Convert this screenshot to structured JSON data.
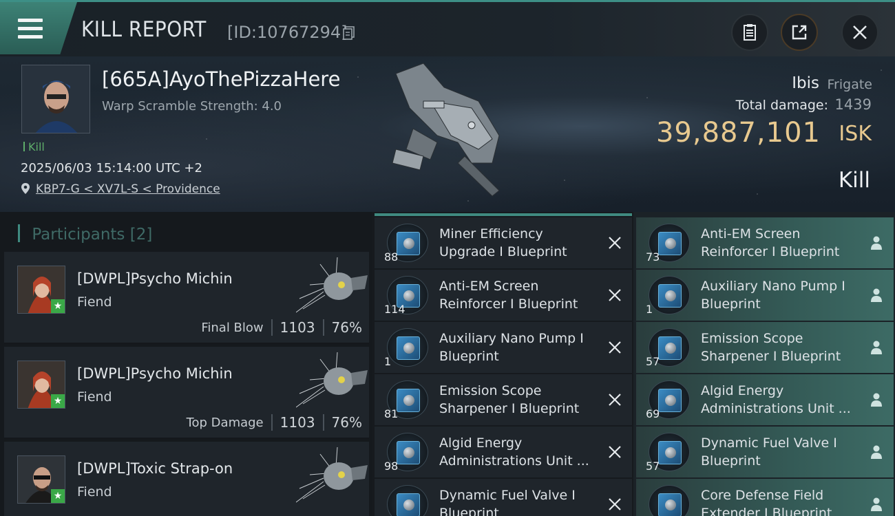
{
  "header": {
    "title": "KILL REPORT",
    "report_id": "[ID:10767294]"
  },
  "victim": {
    "pilot_name": "[665A]AyoThePizzaHere",
    "warp_scramble": "Warp Scramble Strength: 4.0",
    "kill_tag": "Kill",
    "timestamp": "2025/06/03 15:14:00 UTC +2",
    "location": "KBP7-G < XV7L-S < Providence",
    "ship_name": "Ibis",
    "ship_class": "Frigate",
    "total_damage_label": "Total damage:",
    "total_damage_value": "1439",
    "isk_value": "39,887,101",
    "isk_unit": "ISK",
    "result": "Kill"
  },
  "participants": {
    "header": "Participants",
    "count": "[2]",
    "rows": [
      {
        "name": "[DWPL]Psycho Michin",
        "ship": "Fiend",
        "stat_label": "Final Blow",
        "damage": "1103",
        "percent": "76%"
      },
      {
        "name": "[DWPL]Psycho Michin",
        "ship": "Fiend",
        "stat_label": "Top Damage",
        "damage": "1103",
        "percent": "76%"
      },
      {
        "name": "[DWPL]Toxic Strap-on",
        "ship": "Fiend",
        "stat_label": "",
        "damage": "",
        "percent": ""
      }
    ]
  },
  "dropped_items": [
    {
      "qty": "88",
      "line1": "Miner Efficiency",
      "line2": "Upgrade I Blueprint"
    },
    {
      "qty": "114",
      "line1": "Anti-EM Screen",
      "line2": "Reinforcer I Blueprint"
    },
    {
      "qty": "1",
      "line1": "Auxiliary Nano Pump I",
      "line2": "Blueprint"
    },
    {
      "qty": "81",
      "line1": "Emission Scope",
      "line2": "Sharpener I Blueprint"
    },
    {
      "qty": "98",
      "line1": "Algid Energy",
      "line2": "Administrations Unit ..."
    },
    {
      "qty": "",
      "line1": "Dynamic Fuel Valve I",
      "line2": "Blueprint"
    }
  ],
  "destroyed_items": [
    {
      "qty": "73",
      "line1": "Anti-EM Screen",
      "line2": "Reinforcer I Blueprint"
    },
    {
      "qty": "1",
      "line1": "Auxiliary Nano Pump I",
      "line2": "Blueprint"
    },
    {
      "qty": "57",
      "line1": "Emission Scope",
      "line2": "Sharpener I Blueprint"
    },
    {
      "qty": "69",
      "line1": "Algid Energy",
      "line2": "Administrations Unit ..."
    },
    {
      "qty": "57",
      "line1": "Dynamic Fuel Valve I",
      "line2": "Blueprint"
    },
    {
      "qty": "",
      "line1": "Core Defense Field",
      "line2": "Extender I Blueprint"
    }
  ],
  "colors": {
    "accent_teal": "#3f8a80",
    "isk_gold": "#e8c98f",
    "kill_green": "#5fae6a"
  },
  "icons": {
    "menu": "hamburger-icon",
    "copy": "copy-icon",
    "clipboard": "clipboard-icon",
    "share": "share-icon",
    "close": "close-icon",
    "location": "location-pin-icon",
    "dropped_action": "x-icon",
    "destroyed_action": "person-icon"
  }
}
